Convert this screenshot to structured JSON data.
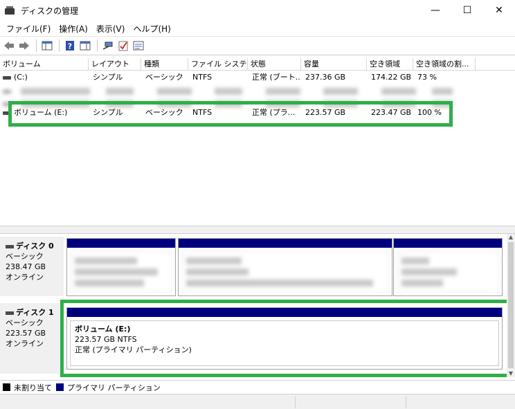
{
  "window": {
    "title": "ディスクの管理",
    "controls": {
      "minimize": "—",
      "maximize": "☐",
      "close": "✕"
    }
  },
  "menu": [
    {
      "label": "ファイル(F)"
    },
    {
      "label": "操作(A)"
    },
    {
      "label": "表示(V)"
    },
    {
      "label": "ヘルプ(H)"
    }
  ],
  "toolbar": {
    "buttons": [
      {
        "icon": "back-arrow-icon"
      },
      {
        "icon": "forward-arrow-icon"
      },
      {
        "icon": "console-tree-icon"
      },
      {
        "icon": "help-icon"
      },
      {
        "icon": "properties-panel-icon"
      },
      {
        "icon": "connect-icon"
      },
      {
        "icon": "checklist-icon"
      },
      {
        "icon": "properties-icon"
      }
    ]
  },
  "volume_list": {
    "columns": [
      "ボリューム",
      "レイアウト",
      "種類",
      "ファイル システム",
      "状態",
      "容量",
      "空き領域",
      "空き領域の割..."
    ],
    "rows": [
      {
        "volume": "(C:)",
        "layout": "シンプル",
        "type": "ベーシック",
        "fs": "NTFS",
        "status": "正常 (ブート...",
        "capacity": "237.36 GB",
        "free": "174.22 GB",
        "free_pct": "73 %",
        "blurred": false
      },
      {
        "volume": "",
        "layout": "",
        "type": "",
        "fs": "",
        "status": "",
        "capacity": "",
        "free": "",
        "free_pct": "",
        "blurred": true
      },
      {
        "volume": "",
        "layout": "",
        "type": "",
        "fs": "",
        "status": "",
        "capacity": "",
        "free": "",
        "free_pct": "",
        "blurred": true
      },
      {
        "volume": "ボリューム (E:)",
        "layout": "シンプル",
        "type": "ベーシック",
        "fs": "NTFS",
        "status": "正常 (プラ...",
        "capacity": "223.57 GB",
        "free": "223.47 GB",
        "free_pct": "100 %",
        "blurred": false
      }
    ]
  },
  "disks": [
    {
      "name": "ディスク 0",
      "type": "ベーシック",
      "size": "238.47 GB",
      "state": "オンライン",
      "partitions": [
        {
          "blurred": true
        },
        {
          "blurred": true
        },
        {
          "blurred": true
        }
      ]
    },
    {
      "name": "ディスク 1",
      "type": "ベーシック",
      "size": "223.57 GB",
      "state": "オンライン",
      "partitions": [
        {
          "blurred": false,
          "name": "ボリューム  (E:)",
          "size_fs": "223.57 GB NTFS",
          "status": "正常 (プライマリ パーティション)"
        }
      ]
    }
  ],
  "legend": [
    {
      "color": "#000000",
      "label": "未割り当て"
    },
    {
      "color": "#00007f",
      "label": "プライマリ パーティション"
    }
  ],
  "colors": {
    "highlight": "#2fae4a",
    "primary_partition": "#00007f"
  }
}
